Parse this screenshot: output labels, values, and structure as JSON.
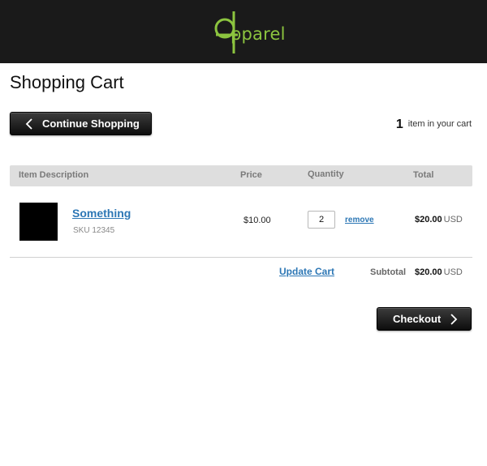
{
  "brand": {
    "logo_text": "pparel",
    "accent": "#8cc43f"
  },
  "page": {
    "title": "Shopping Cart"
  },
  "toolbar": {
    "continue_label": "Continue Shopping",
    "item_count": "1",
    "item_count_text": "item in your cart"
  },
  "table": {
    "headers": [
      "Item Description",
      "Price",
      "Quantity",
      "Total"
    ]
  },
  "cart_items": [
    {
      "name": "Something",
      "sku": "SKU 12345",
      "price": "$10.00",
      "quantity": "2",
      "remove_label": "remove",
      "total": "$20.00",
      "currency": "USD"
    }
  ],
  "summary": {
    "update_label": "Update Cart",
    "subtotal_label": "Subtotal",
    "subtotal_value": "$20.00",
    "currency": "USD"
  },
  "checkout": {
    "label": "Checkout"
  },
  "colors": {
    "header_bg": "#1a1a1a",
    "link": "#2d77b5",
    "table_header_bg": "#dedede"
  }
}
